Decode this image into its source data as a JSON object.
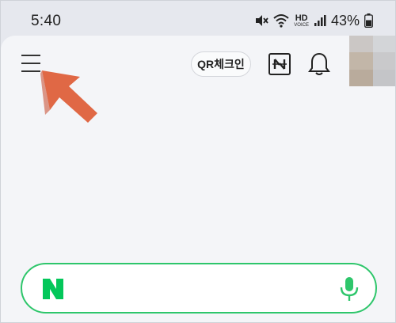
{
  "status_bar": {
    "time": "5:40",
    "network_label": "HD",
    "network_sublabel": "VOICE",
    "battery_percent": "43%"
  },
  "header": {
    "qr_checkin_label": "QR체크인"
  },
  "icons": {
    "menu": "hamburger-menu-icon",
    "news": "n-news-icon",
    "notifications": "bell-icon",
    "annotation": "arrow-pointer-icon",
    "search_logo": "naver-n-logo",
    "voice": "microphone-icon"
  },
  "colors": {
    "accent_green": "#2ec66b",
    "naver_green": "#03c75a",
    "annotation_arrow": "#e06845",
    "background": "#f4f5f8"
  }
}
